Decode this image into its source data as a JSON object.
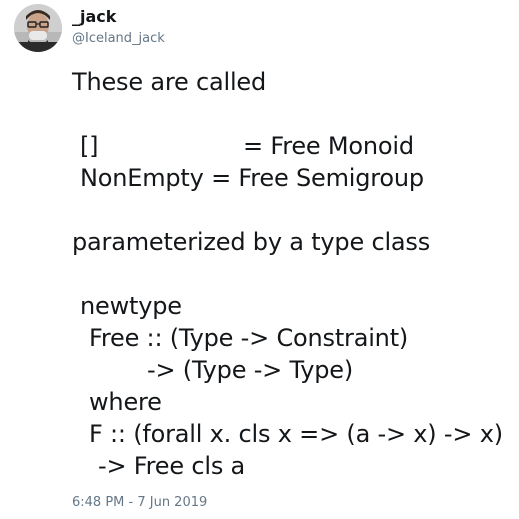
{
  "author": {
    "display_name": "_jack",
    "handle": "@Iceland_jack"
  },
  "tweet": {
    "lines": [
      "These are called",
      "[]",
      "= Free Monoid",
      "NonEmpty = Free Semigroup",
      "parameterized by a type class",
      "newtype",
      "Free :: (Type -> Constraint)",
      "-> (Type -> Type)",
      "where",
      "F :: (forall x. cls x => (a -> x) -> x)",
      "-> Free cls a"
    ],
    "timestamp": "6:48 PM - 7 Jun 2019"
  },
  "colors": {
    "text": "#14171a",
    "secondary": "#657786",
    "background": "#ffffff"
  }
}
